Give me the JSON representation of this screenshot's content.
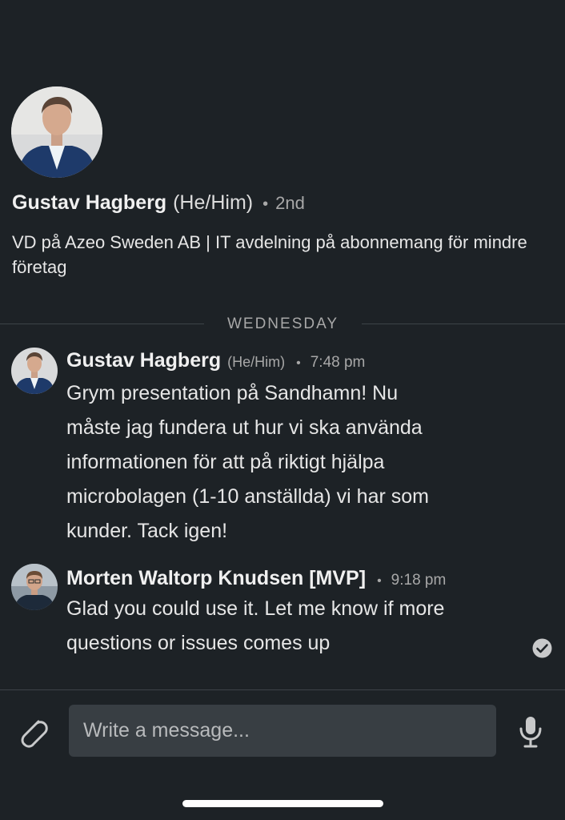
{
  "profile": {
    "name": "Gustav Hagberg",
    "pronouns": "(He/Him)",
    "separator": "•",
    "degree": "2nd",
    "headline": "VD på Azeo Sweden AB | IT avdelning på abonnemang för mindre företag"
  },
  "day_separator": "WEDNESDAY",
  "messages": [
    {
      "sender": "Gustav Hagberg",
      "pronouns": "(He/Him)",
      "separator": "•",
      "time": "7:48 pm",
      "lines": [
        "Grym presentation på Sandhamn! Nu",
        "måste jag fundera ut hur vi ska använda",
        "informationen för att på riktigt hjälpa",
        "microbolagen (1-10 anställda) vi har som",
        "kunder. Tack igen!"
      ]
    },
    {
      "sender": "Morten Waltorp Knudsen [MVP]",
      "separator": "•",
      "time": "9:18 pm",
      "lines": [
        "Glad you could use it. Let me know if more",
        "questions or issues comes up"
      ]
    }
  ],
  "composer": {
    "placeholder": "Write a message..."
  },
  "icons": {
    "attach": "paperclip-icon",
    "mic": "microphone-icon",
    "read": "read-receipt-check-icon"
  },
  "colors": {
    "background": "#1d2226",
    "input_background": "#383e43",
    "divider": "#3d4348",
    "secondary_text": "#a8a8a8"
  }
}
